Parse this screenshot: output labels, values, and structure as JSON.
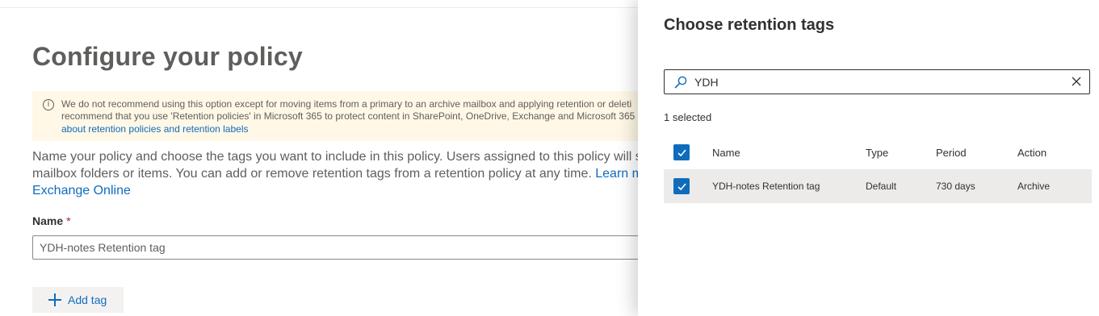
{
  "page": {
    "title": "Configure your policy",
    "warning": {
      "line1": "We do not recommend using this option except for moving items from a primary to an archive mailbox and applying retention or deleti",
      "line2": "recommend that you use 'Retention policies' in Microsoft 365 to protect content in SharePoint, OneDrive, Exchange and Microsoft 365 G",
      "link": "about retention policies and retention labels"
    },
    "description": {
      "line1": "Name your policy and choose the tags you want to include in this policy. Users assigned to this policy will s",
      "line2": "mailbox folders or items. You can add or remove retention tags from a retention policy at any time.",
      "learn_link": "Learn m",
      "line3_link": "Exchange Online"
    },
    "name_label": "Name",
    "required_marker": "*",
    "name_value": "YDH-notes Retention tag",
    "add_tag_label": "Add tag"
  },
  "panel": {
    "title": "Choose retention tags",
    "search_value": "YDH",
    "selected_count": "1 selected",
    "columns": {
      "name": "Name",
      "type": "Type",
      "period": "Period",
      "action": "Action"
    },
    "rows": [
      {
        "name": "YDH-notes Retention tag",
        "type": "Default",
        "period": "730 days",
        "action": "Archive",
        "checked": true
      }
    ]
  },
  "colors": {
    "accent": "#0f6cbd",
    "warning_bg": "#fff8e6",
    "selected_row": "#edebe9"
  }
}
